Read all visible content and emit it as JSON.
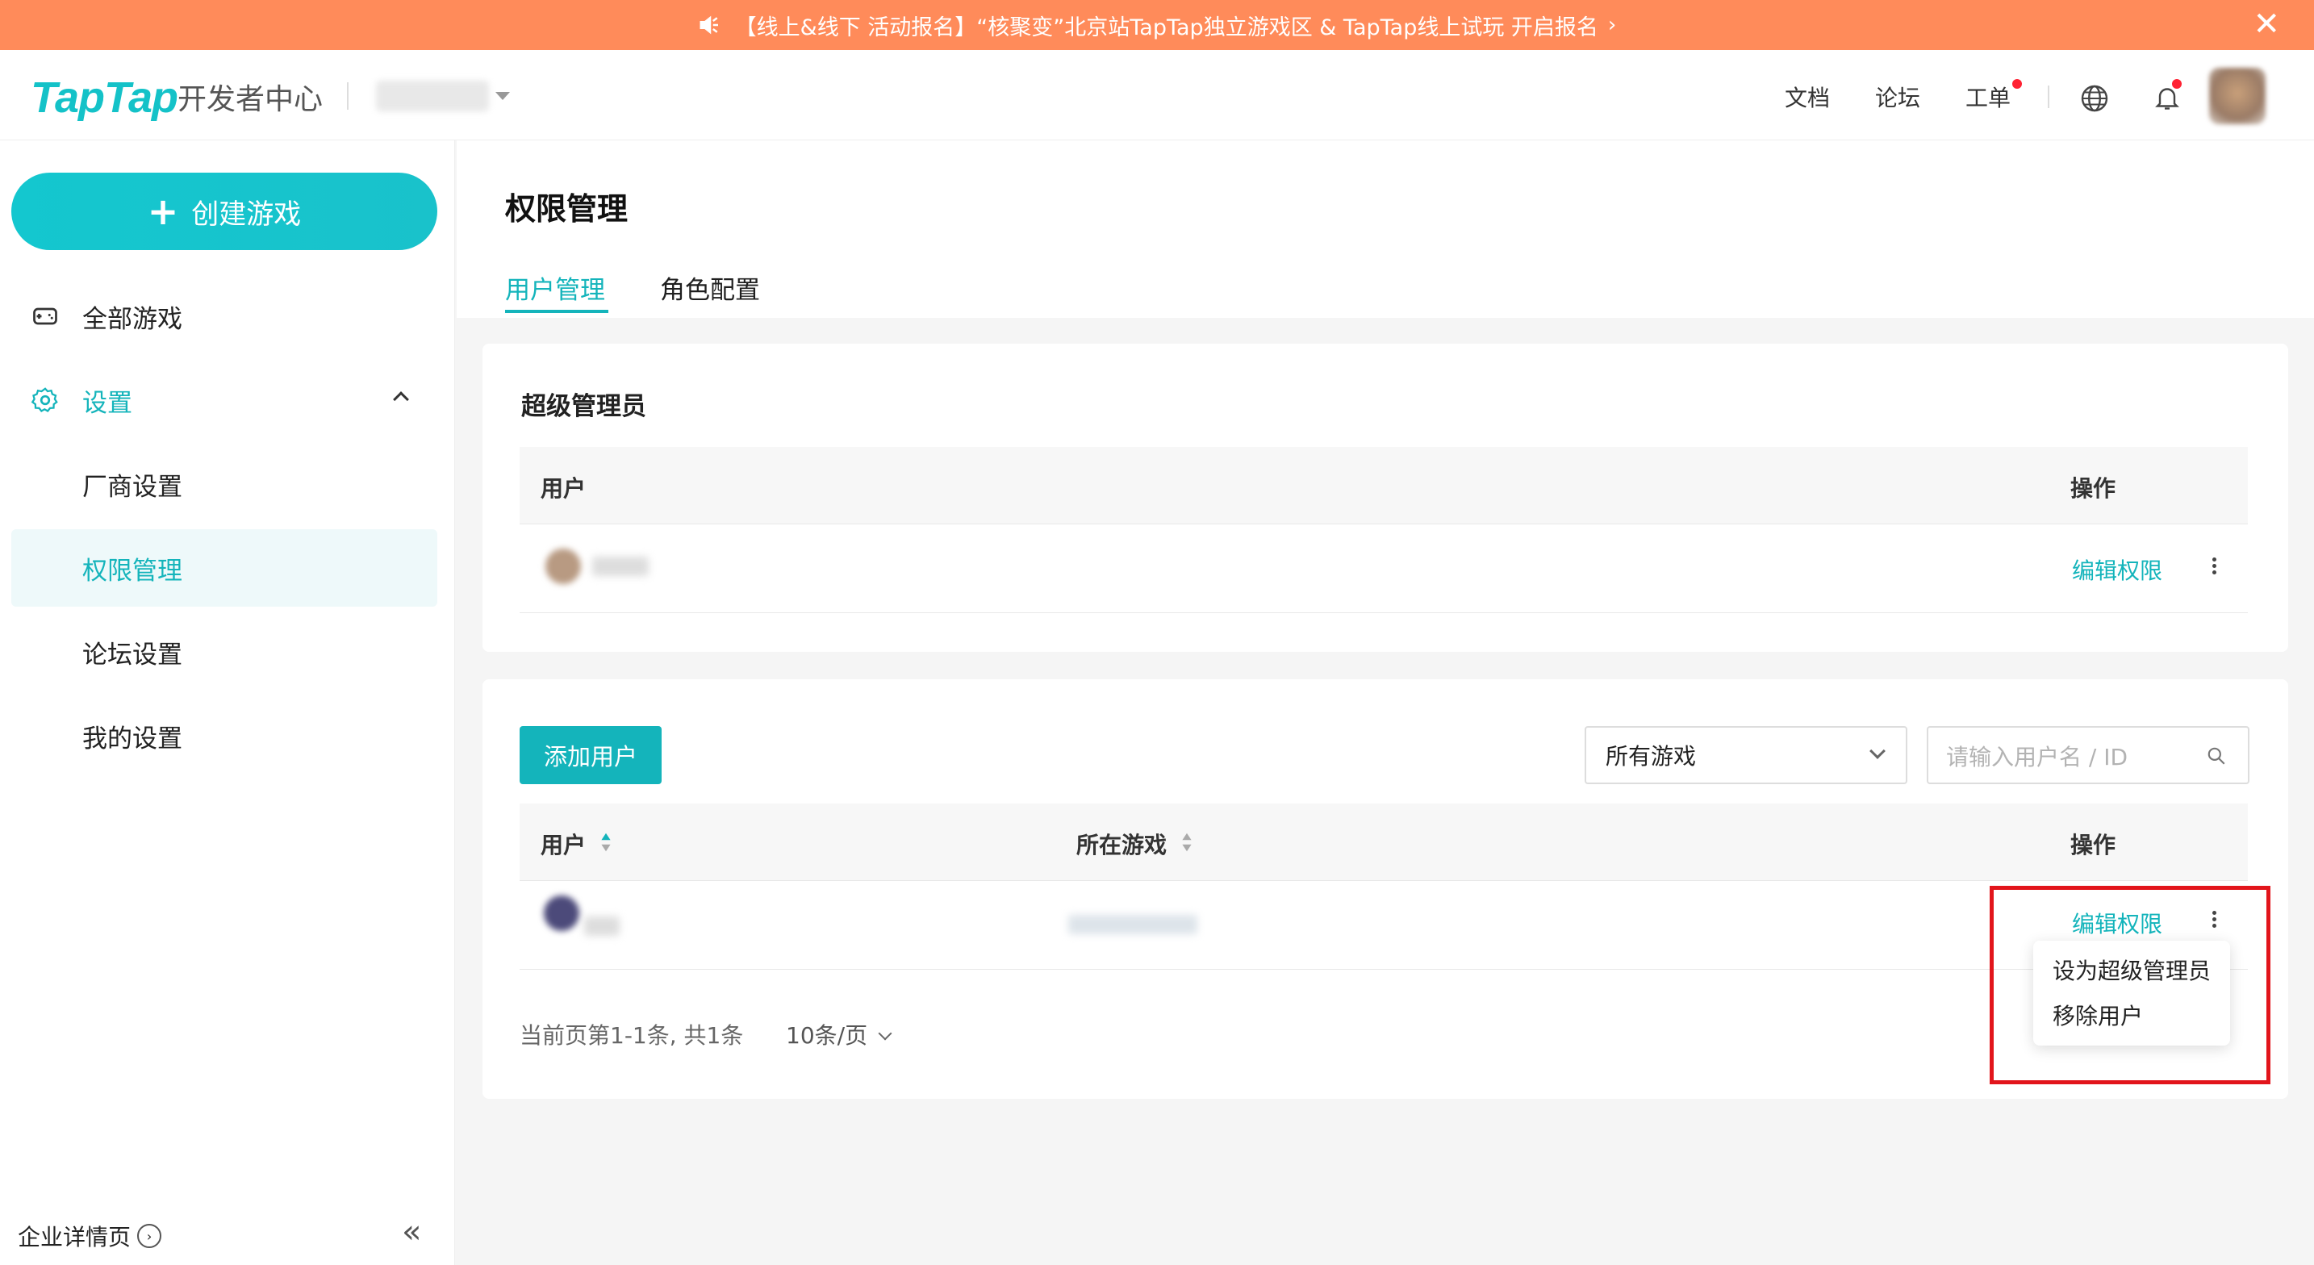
{
  "banner": {
    "text": "【线上&线下 活动报名】“核聚变”北京站TapTap独立游戏区 & TapTap线上试玩 开启报名",
    "arrow": "›",
    "close": "✕"
  },
  "header": {
    "logo": "TapTap",
    "logo_sub": "开发者中心",
    "links": {
      "docs": "文档",
      "forum": "论坛",
      "tickets": "工单"
    }
  },
  "sidebar": {
    "create_button": "创建游戏",
    "items": {
      "all_games": "全部游戏",
      "settings": "设置",
      "vendor": "厂商设置",
      "permissions": "权限管理",
      "forum_settings": "论坛设置",
      "my_settings": "我的设置"
    },
    "company_link": "企业详情页",
    "collapse": "«"
  },
  "page": {
    "title": "权限管理",
    "tabs": {
      "users": "用户管理",
      "roles": "角色配置"
    }
  },
  "super_admin": {
    "title": "超级管理员",
    "col_user": "用户",
    "col_action": "操作",
    "row_action": "编辑权限"
  },
  "users": {
    "add_button": "添加用户",
    "game_filter": "所有游戏",
    "search_placeholder": "请输入用户名 / ID",
    "col_user": "用户",
    "col_game": "所在游戏",
    "col_action": "操作",
    "row_action": "编辑权限",
    "pager_text": "当前页第1-1条, 共1条",
    "page_size": "10条/页"
  },
  "row_menu": {
    "set_super_admin": "设为超级管理员",
    "remove_user": "移除用户"
  },
  "colors": {
    "accent": "#14b4bb",
    "banner": "#ff8b5a",
    "highlight": "#e2151b"
  }
}
